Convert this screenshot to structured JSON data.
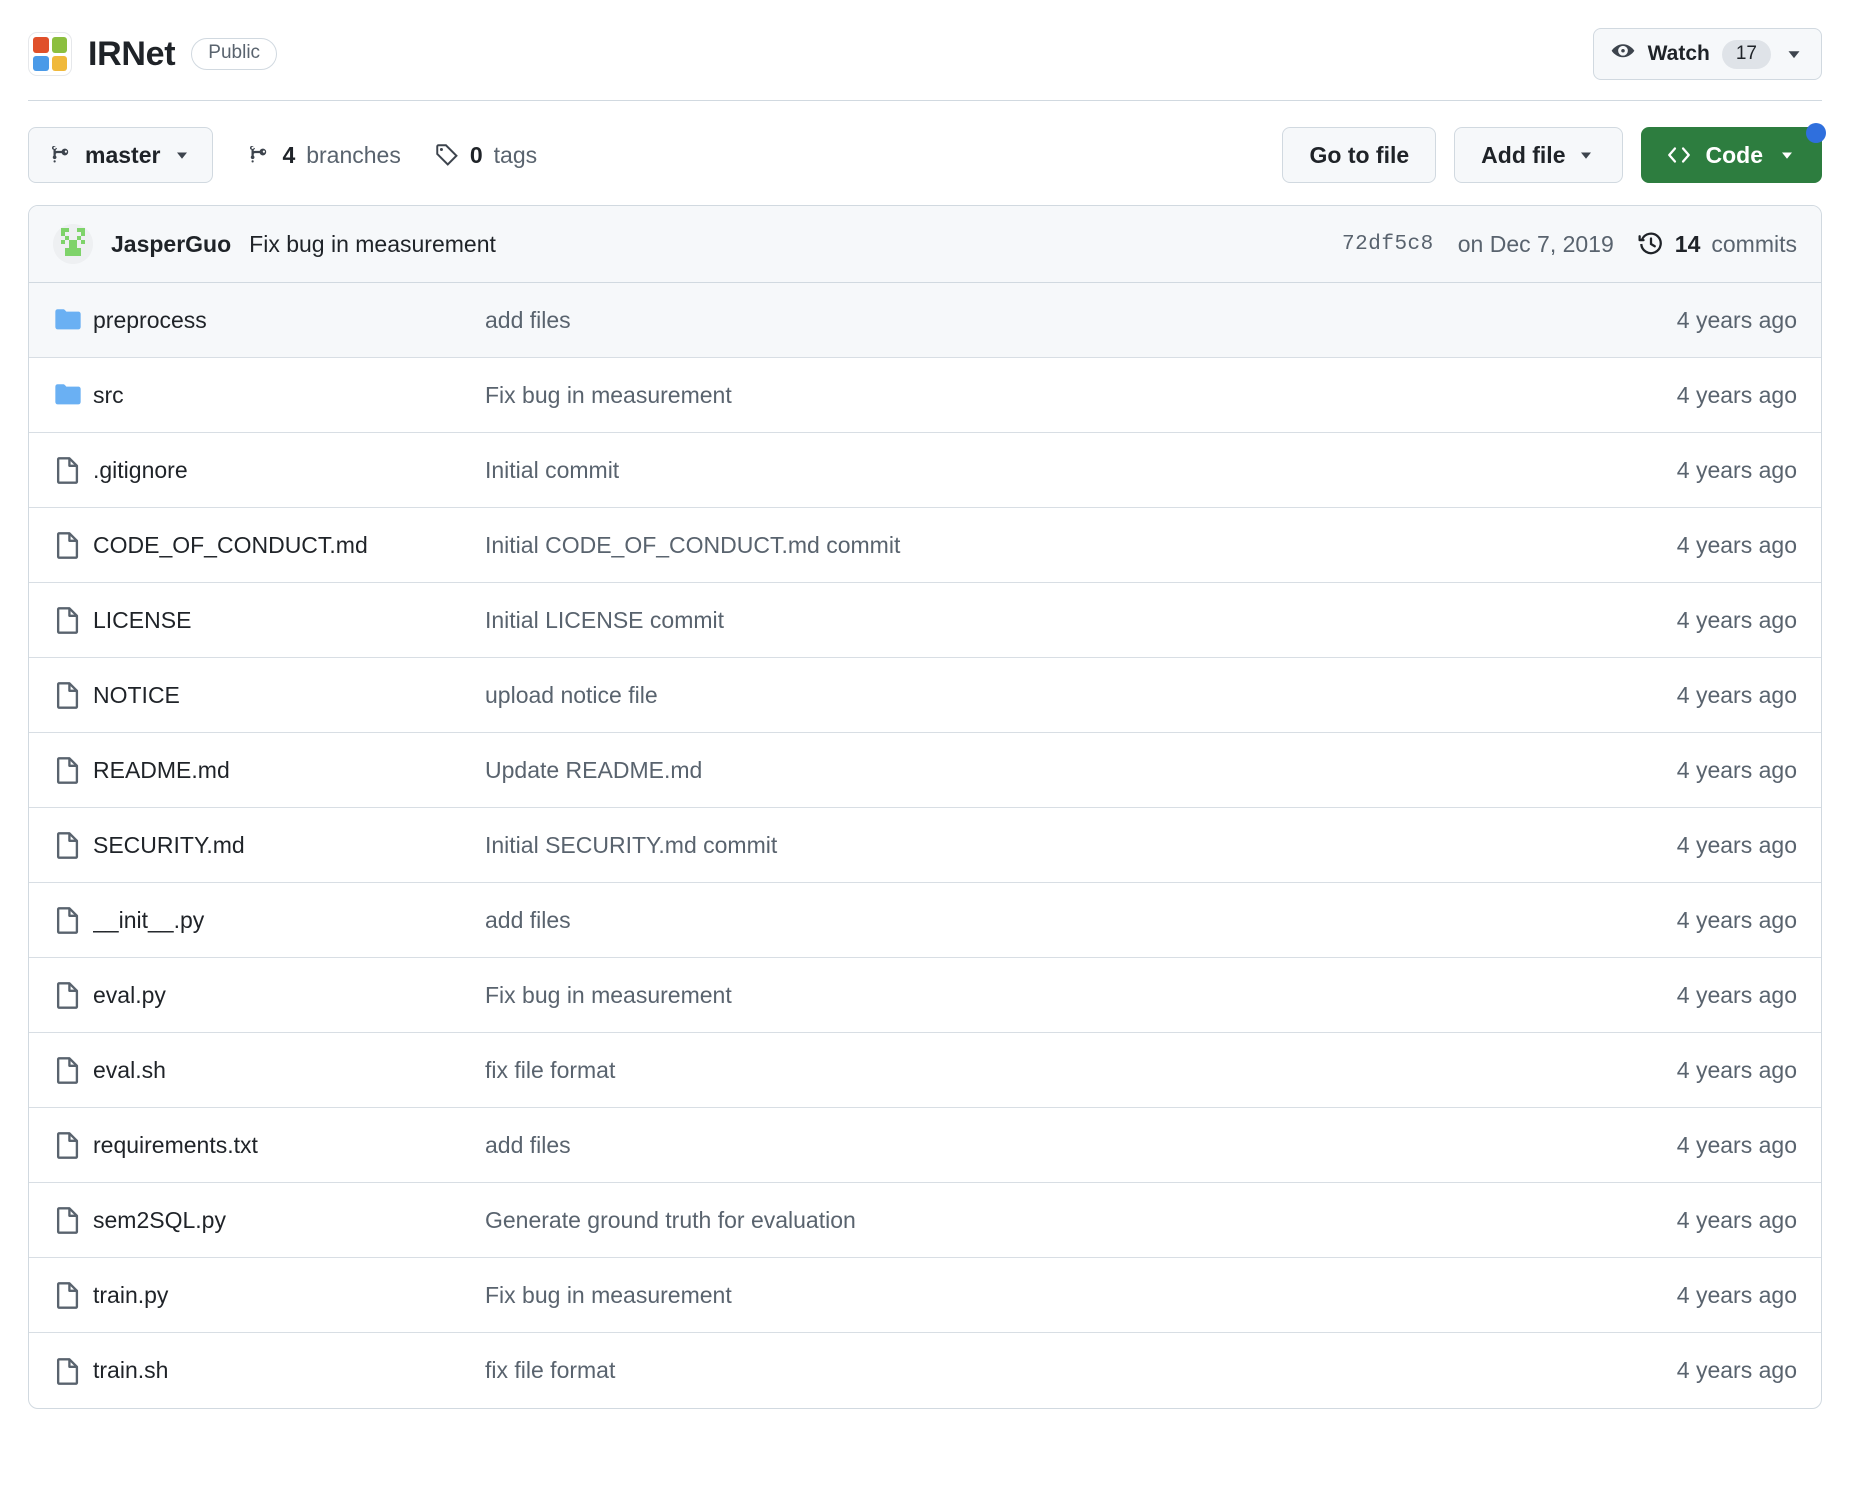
{
  "repo": {
    "name": "IRNet",
    "visibility": "Public",
    "logo_colors": [
      "#e0502a",
      "#8cbf3f",
      "#4a9ae8",
      "#f0b93b"
    ]
  },
  "watch": {
    "label": "Watch",
    "count": "17",
    "icon": "eye-icon",
    "chevron": "chevron-down-icon"
  },
  "toolbar": {
    "branch": "master",
    "branches_count": "4",
    "branches_label": "branches",
    "tags_count": "0",
    "tags_label": "tags",
    "go_to_file": "Go to file",
    "add_file": "Add file",
    "code": "Code"
  },
  "latest_commit": {
    "author": "JasperGuo",
    "message": "Fix bug in measurement",
    "sha": "72df5c8",
    "date": "on Dec 7, 2019",
    "commits_count": "14",
    "commits_label": "commits"
  },
  "files": [
    {
      "type": "folder",
      "name": "preprocess",
      "message": "add files",
      "age": "4 years ago"
    },
    {
      "type": "folder",
      "name": "src",
      "message": "Fix bug in measurement",
      "age": "4 years ago"
    },
    {
      "type": "file",
      "name": ".gitignore",
      "message": "Initial commit",
      "age": "4 years ago"
    },
    {
      "type": "file",
      "name": "CODE_OF_CONDUCT.md",
      "message": "Initial CODE_OF_CONDUCT.md commit",
      "age": "4 years ago"
    },
    {
      "type": "file",
      "name": "LICENSE",
      "message": "Initial LICENSE commit",
      "age": "4 years ago"
    },
    {
      "type": "file",
      "name": "NOTICE",
      "message": "upload notice file",
      "age": "4 years ago"
    },
    {
      "type": "file",
      "name": "README.md",
      "message": "Update README.md",
      "age": "4 years ago"
    },
    {
      "type": "file",
      "name": "SECURITY.md",
      "message": "Initial SECURITY.md commit",
      "age": "4 years ago"
    },
    {
      "type": "file",
      "name": "__init__.py",
      "message": "add files",
      "age": "4 years ago"
    },
    {
      "type": "file",
      "name": "eval.py",
      "message": "Fix bug in measurement",
      "age": "4 years ago"
    },
    {
      "type": "file",
      "name": "eval.sh",
      "message": "fix file format",
      "age": "4 years ago"
    },
    {
      "type": "file",
      "name": "requirements.txt",
      "message": "add files",
      "age": "4 years ago"
    },
    {
      "type": "file",
      "name": "sem2SQL.py",
      "message": "Generate ground truth for evaluation",
      "age": "4 years ago"
    },
    {
      "type": "file",
      "name": "train.py",
      "message": "Fix bug in measurement",
      "age": "4 years ago"
    },
    {
      "type": "file",
      "name": "train.sh",
      "message": "fix file format",
      "age": "4 years ago"
    }
  ],
  "colors": {
    "code_button_green": "#2d7d3f",
    "notification_dot_blue": "#2f6fdd",
    "folder_blue": "#6ab0f3",
    "border": "#d1d9e0"
  }
}
